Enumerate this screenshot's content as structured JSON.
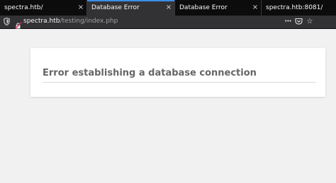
{
  "tabs": [
    {
      "title": "spectra.htb/",
      "active": false
    },
    {
      "title": "Database Error",
      "active": true
    },
    {
      "title": "Database Error",
      "active": false
    },
    {
      "title": "spectra.htb:8081/",
      "active": false
    }
  ],
  "tab_close_glyph": "×",
  "urlbar": {
    "domain": "spectra.htb",
    "path": "/testing/index.php"
  },
  "nav_icons": {
    "more": "•••",
    "pocket": "pocket-icon",
    "bookmark": "☆"
  },
  "page": {
    "heading": "Error establishing a database connection"
  },
  "colors": {
    "tab_active_accent": "#3a8ee6",
    "tab_bg": "#0c0c0d",
    "toolbar_bg": "#323234",
    "page_bg": "#f1f1f1",
    "heading": "#666666"
  }
}
